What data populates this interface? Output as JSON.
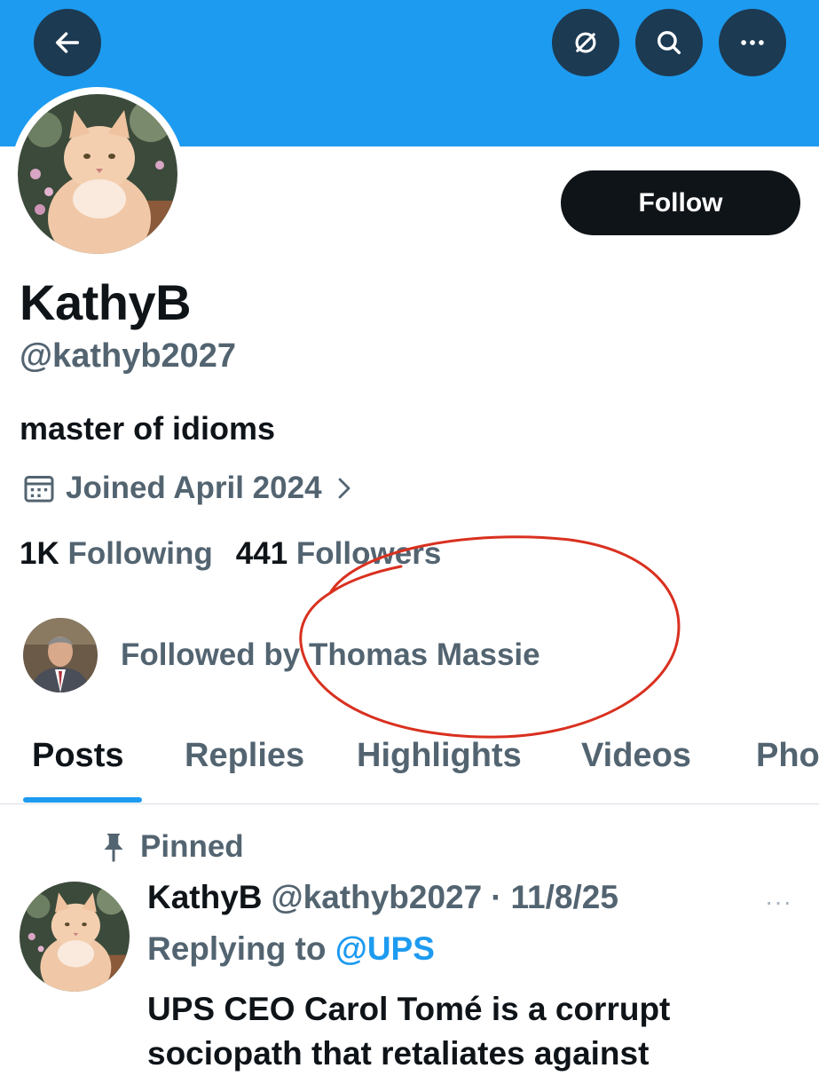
{
  "header": {
    "back_icon": "arrow-left-icon",
    "grok_icon": "slashed-circle-icon",
    "search_icon": "search-icon",
    "more_icon": "more-horizontal-icon",
    "banner_color": "#1d9bf0"
  },
  "profile": {
    "display_name": "KathyB",
    "handle": "@kathyb2027",
    "bio": "master of idioms",
    "joined": "Joined April 2024",
    "follow_label": "Follow",
    "following_count": "1K",
    "following_label": "Following",
    "followers_count": "441",
    "followers_label": "Followers",
    "followed_by": "Followed by Thomas Massie"
  },
  "tabs": [
    {
      "label": "Posts",
      "active": true
    },
    {
      "label": "Replies",
      "active": false
    },
    {
      "label": "Highlights",
      "active": false
    },
    {
      "label": "Videos",
      "active": false
    },
    {
      "label": "Pho",
      "active": false
    }
  ],
  "post": {
    "pinned_label": "Pinned",
    "author_name": "KathyB",
    "author_handle": "@kathyb2027",
    "separator": "·",
    "date": "11/8/25",
    "replying_prefix": "Replying to",
    "replying_to": "@UPS",
    "more_dots": "···",
    "text_line1": "UPS CEO Carol Tomé is a corrupt",
    "text_line2": "sociopath that retaliates against"
  },
  "colors": {
    "accent": "#1d9bf0",
    "text_primary": "#0f1419",
    "text_secondary": "#536471",
    "annotation_red": "#d9301f"
  }
}
